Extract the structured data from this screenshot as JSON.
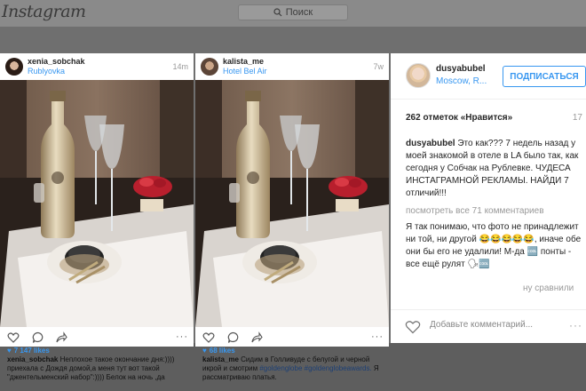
{
  "background": {
    "logo": "Instagram",
    "search_placeholder": "Поиск"
  },
  "posts": [
    {
      "username": "xenia_sobchak",
      "location": "Rublyovka",
      "time": "14m",
      "likes": "7 147 likes",
      "caption_user": "xenia_sobchak",
      "caption_text": "Неплохое такое окончание дня:)))) приехала с Дождя домой,а меня тут вот такой \"джентельменский набор\":)))) Белок на ночь ,да"
    },
    {
      "username": "kalista_me",
      "location": "Hotel Bel Air",
      "time": "7w",
      "likes": "68 likes",
      "caption_user": "kalista_me",
      "caption_text": "Сидим в Голливуде с белугой и черной икрой и смотрим",
      "caption_tags": "#goldenglobe #goldenglobeawards.",
      "caption_tail": "Я рассматриваю платья."
    }
  ],
  "modal": {
    "username": "dusyabubel",
    "location": "Moscow, R...",
    "follow_label": "ПОДПИСАТЬСЯ",
    "likes": "262 отметок «Нравится»",
    "time": "17",
    "caption_user": "dusyabubel",
    "caption_text": "Это как??? 7 недель назад у моей знакомой в отеле в LA было так, как сегодня у Собчак на Рублевке. ЧУДЕСА ИНСТАГРАМНОЙ РЕКЛАМЫ. НАЙДИ 7 отличий!!!",
    "view_all": "посмотреть все 71 комментариев",
    "comment": "Я так понимаю, что фото не принадлежит ни той, ни другой 😂😂😂😂😂, иначе обе они бы его не удалили! М-да 🆒 понты - все ещё рулят 🗣🆒",
    "comment_faded": "ну сравнили",
    "add_comment": "Добавьте комментарий...",
    "more": "···"
  },
  "colors": {
    "link_blue": "#3897f0",
    "text": "#262626",
    "muted": "#999999"
  }
}
